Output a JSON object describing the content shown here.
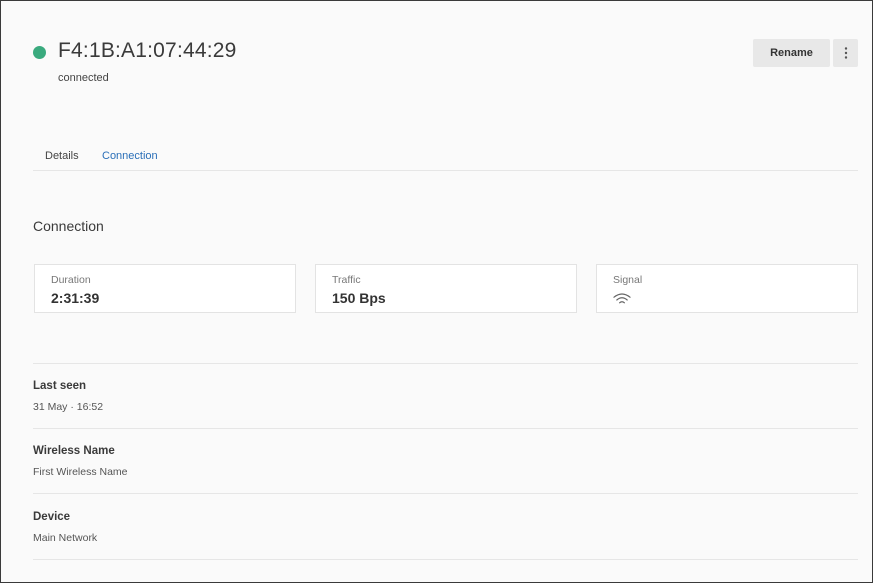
{
  "device": {
    "mac_address": "F4:1B:A1:07:44:29",
    "status": "connected",
    "status_color": "#3aaa7e"
  },
  "actions": {
    "rename_label": "Rename",
    "more_icon": "more-vertical-icon"
  },
  "tabs": [
    {
      "label": "Details",
      "active": false
    },
    {
      "label": "Connection",
      "active": true
    }
  ],
  "connection": {
    "section_title": "Connection",
    "cards": [
      {
        "label": "Duration",
        "value": "2:31:39"
      },
      {
        "label": "Traffic",
        "value": "150 Bps"
      },
      {
        "label": "Signal",
        "icon": "wifi-signal-icon"
      }
    ]
  },
  "info": [
    {
      "label": "Last seen",
      "value": "31 May · 16:52"
    },
    {
      "label": "Wireless Name",
      "value": "First Wireless Name"
    },
    {
      "label": "Device",
      "value": "Main Network"
    }
  ],
  "colors": {
    "accent": "#2a6fb8",
    "connected": "#3aaa7e"
  }
}
